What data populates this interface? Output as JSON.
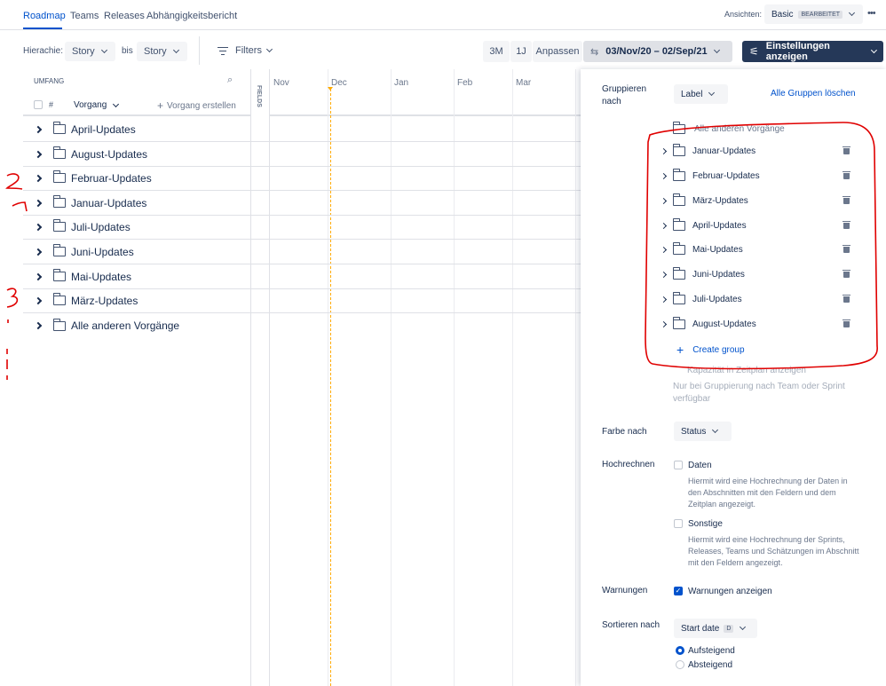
{
  "nav": {
    "tabs": [
      "Roadmap",
      "Teams",
      "Releases",
      "Abhängigkeitsbericht"
    ],
    "view_label": "Ansichten:",
    "view_name": "Basic",
    "view_badge": "BEARBEITET",
    "more": "•••"
  },
  "toolbar": {
    "hierarchy_label": "Hierachie:",
    "hierarchy_from": "Story",
    "bis": "bis",
    "hierarchy_to": "Story",
    "filters": "Filters",
    "btn_3m": "3M",
    "btn_1j": "1J",
    "btn_anpassen": "Anpassen",
    "date_range": "03/Nov/20 – 02/Sep/21",
    "settings": "Einstellungen anzeigen"
  },
  "scope": {
    "header": "UMFANG",
    "hash": "#",
    "vorgang": "Vorgang",
    "create": "Vorgang erstellen",
    "fields": "FIELDS",
    "rows": [
      "April-Updates",
      "August-Updates",
      "Februar-Updates",
      "Januar-Updates",
      "Juli-Updates",
      "Juni-Updates",
      "Mai-Updates",
      "März-Updates",
      "Alle anderen Vorgänge"
    ]
  },
  "timeline": {
    "months": [
      "Nov",
      "Dec",
      "Jan",
      "Feb",
      "Mar"
    ]
  },
  "settings": {
    "group_by_label": "Gruppieren nach",
    "group_by_value": "Label",
    "clear_groups": "Alle Gruppen löschen",
    "other_group": "Alle anderen Vorgänge",
    "groups": [
      "Januar-Updates",
      "Februar-Updates",
      "März-Updates",
      "April-Updates",
      "Mai-Updates",
      "Juni-Updates",
      "Juli-Updates",
      "August-Updates"
    ],
    "create_group": "Create group",
    "capacity": "Kapazität in Zeitplan anzeigen",
    "capacity_note": "Nur bei Gruppierung nach Team oder Sprint verfügbar",
    "color_by_label": "Farbe nach",
    "color_by_value": "Status",
    "rollup_label": "Hochrechnen",
    "rollup_dates": "Daten",
    "rollup_dates_desc": "Hiermit wird eine Hochrechnung der Daten in den Abschnitten mit den Feldern und dem Zeitplan angezeigt.",
    "rollup_other": "Sonstige",
    "rollup_other_desc": "Hiermit wird eine Hochrechnung der Sprints, Releases, Teams und Schätzungen im Abschnitt mit den Feldern angezeigt.",
    "warnings_label": "Warnungen",
    "warnings_value": "Warnungen anzeigen",
    "sort_label": "Sortieren nach",
    "sort_value": "Start date",
    "sort_badge": "D",
    "sort_asc": "Aufsteigend",
    "sort_desc": "Absteigend"
  },
  "colors": {
    "accent": "#0052cc",
    "dark_button": "#253858",
    "annotation": "#e00000"
  }
}
